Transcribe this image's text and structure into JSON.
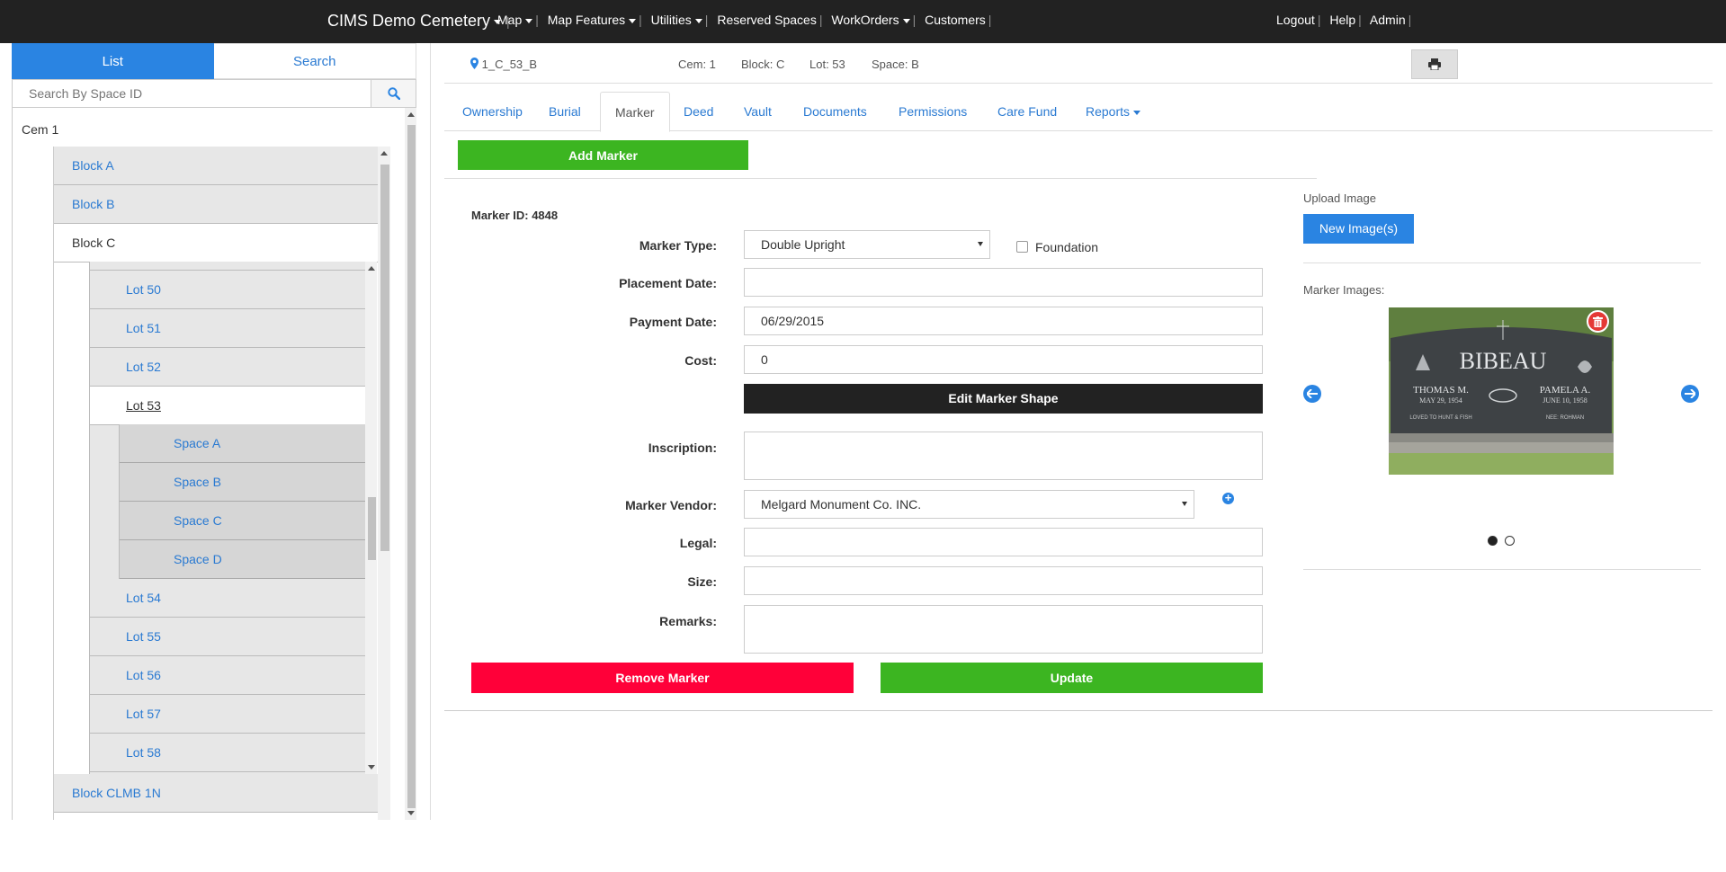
{
  "navbar": {
    "brand": "CIMS Demo Cemetery",
    "left_items": [
      "Map",
      "Map Features",
      "Utilities",
      "Reserved Spaces",
      "WorkOrders",
      "Customers"
    ],
    "right_items": [
      "Logout",
      "Help",
      "Admin"
    ]
  },
  "left_panel": {
    "tabs": [
      "List",
      "Search"
    ],
    "search_placeholder": "Search By Space ID",
    "root": "Cem 1",
    "blocks": [
      "Block A",
      "Block B",
      "Block C",
      "Block CLMB 1N"
    ],
    "lots": [
      "Lot 50",
      "Lot 51",
      "Lot 52",
      "Lot 53",
      "Lot 54",
      "Lot 55",
      "Lot 56",
      "Lot 57",
      "Lot 58"
    ],
    "spaces": [
      "Space A",
      "Space B",
      "Space C",
      "Space D"
    ]
  },
  "info_bar": {
    "space_id": "1_C_53_B",
    "cem": "Cem: 1",
    "block": "Block: C",
    "lot": "Lot: 53",
    "space": "Space: B"
  },
  "tabs": [
    "Ownership",
    "Burial",
    "Marker",
    "Deed",
    "Vault",
    "Documents",
    "Permissions",
    "Care Fund",
    "Reports"
  ],
  "active_tab": "Marker",
  "form": {
    "add_marker_label": "Add Marker",
    "marker_id": "Marker ID: 4848",
    "marker_type_label": "Marker Type:",
    "marker_type_value": "Double Upright",
    "foundation_label": "Foundation",
    "placement_date_label": "Placement Date:",
    "placement_date_value": "",
    "payment_date_label": "Payment Date:",
    "payment_date_value": "06/29/2015",
    "cost_label": "Cost:",
    "cost_value": "0",
    "edit_shape_label": "Edit Marker Shape",
    "inscription_label": "Inscription:",
    "vendor_label": "Marker Vendor:",
    "vendor_value": "Melgard Monument Co. INC.",
    "legal_label": "Legal:",
    "size_label": "Size:",
    "remarks_label": "Remarks:",
    "remove_label": "Remove Marker",
    "update_label": "Update"
  },
  "images": {
    "upload_label": "Upload Image",
    "new_images_label": "New Image(s)",
    "marker_images_label": "Marker Images:",
    "headstone": {
      "family": "BIBEAU",
      "left_name": "THOMAS M.",
      "left_date": "MAY 29, 1954",
      "right_name": "PAMELA A.",
      "right_date": "JUNE 10, 1958",
      "left_epitaph": "LOVED TO HUNT & FISH",
      "right_epitaph": "NEE: ROHMAN"
    },
    "slide_count": 2,
    "active_slide": 1
  },
  "colors": {
    "navbar": "#222222",
    "primary": "#2a84e2",
    "link": "#2a7ad2",
    "success": "#3cb521",
    "danger": "#ff0039"
  }
}
